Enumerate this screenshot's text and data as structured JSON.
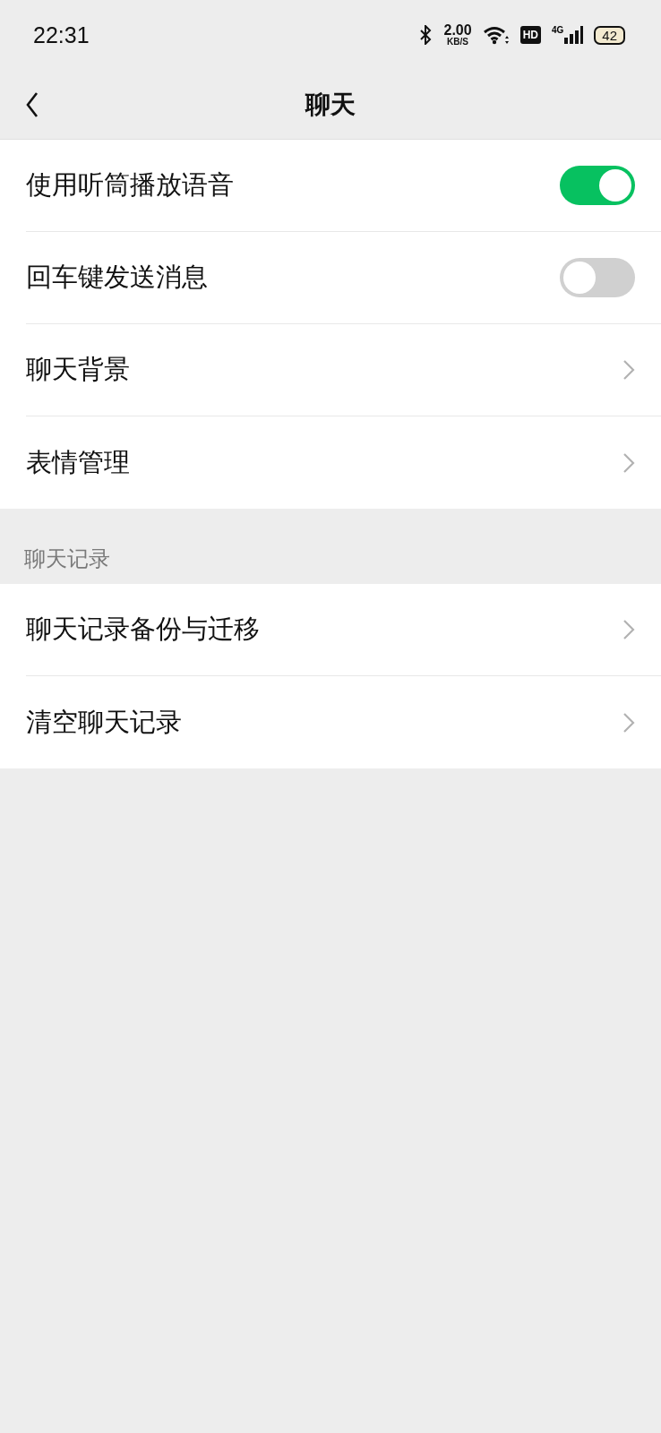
{
  "status_bar": {
    "time": "22:31",
    "speed": "2.00",
    "speed_unit": "KB/S",
    "hd": "HD",
    "network": "4G",
    "battery": "42"
  },
  "header": {
    "title": "聊天"
  },
  "groups": [
    {
      "items": [
        {
          "kind": "toggle",
          "label": "使用听筒播放语音",
          "on": true
        },
        {
          "kind": "toggle",
          "label": "回车键发送消息",
          "on": false
        },
        {
          "kind": "link",
          "label": "聊天背景"
        },
        {
          "kind": "link",
          "label": "表情管理"
        }
      ]
    },
    {
      "title": "聊天记录",
      "items": [
        {
          "kind": "link",
          "label": "聊天记录备份与迁移"
        },
        {
          "kind": "link",
          "label": "清空聊天记录"
        }
      ]
    }
  ]
}
